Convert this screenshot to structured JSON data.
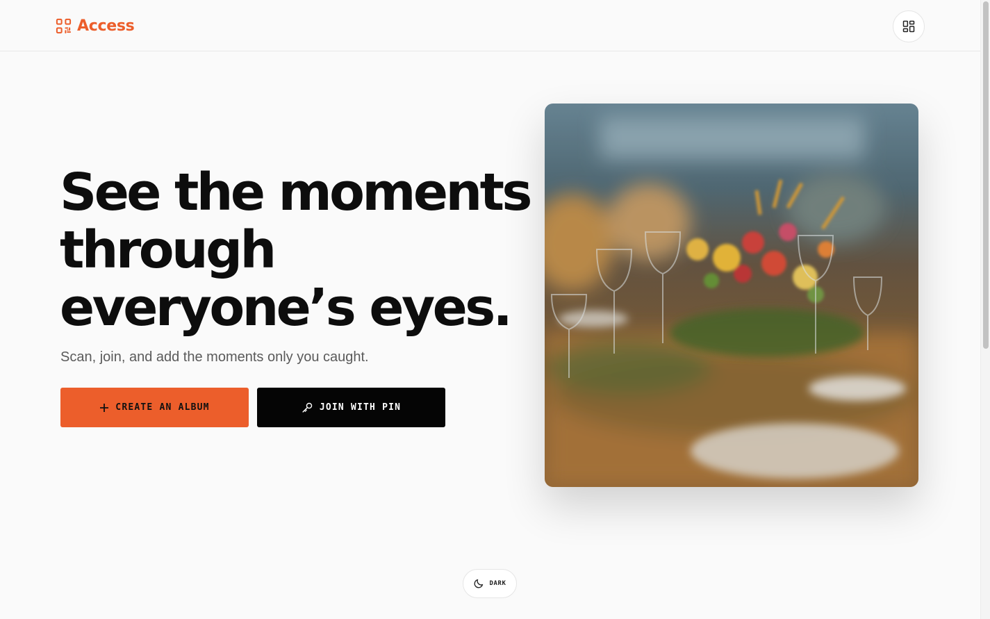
{
  "header": {
    "brand_name": "Access",
    "brand_color": "#ec5e2b",
    "brand_icon": "qr-code-icon",
    "menu_icon": "grid-icon"
  },
  "hero": {
    "headline_lines": [
      "See the moments",
      "through",
      "everyone’s eyes."
    ],
    "subtitle": "Scan, join, and add the moments only you caught.",
    "create_button": {
      "label": "CREATE AN ALBUM",
      "icon": "plus-icon",
      "color": "#ec5e2b"
    },
    "join_button": {
      "label": "JOIN WITH PIN",
      "icon": "key-icon",
      "color": "#050505"
    },
    "image_icon": "banquet-table-photo"
  },
  "footer": {
    "theme_toggle": {
      "label": "DARK",
      "icon": "moon-icon"
    }
  }
}
